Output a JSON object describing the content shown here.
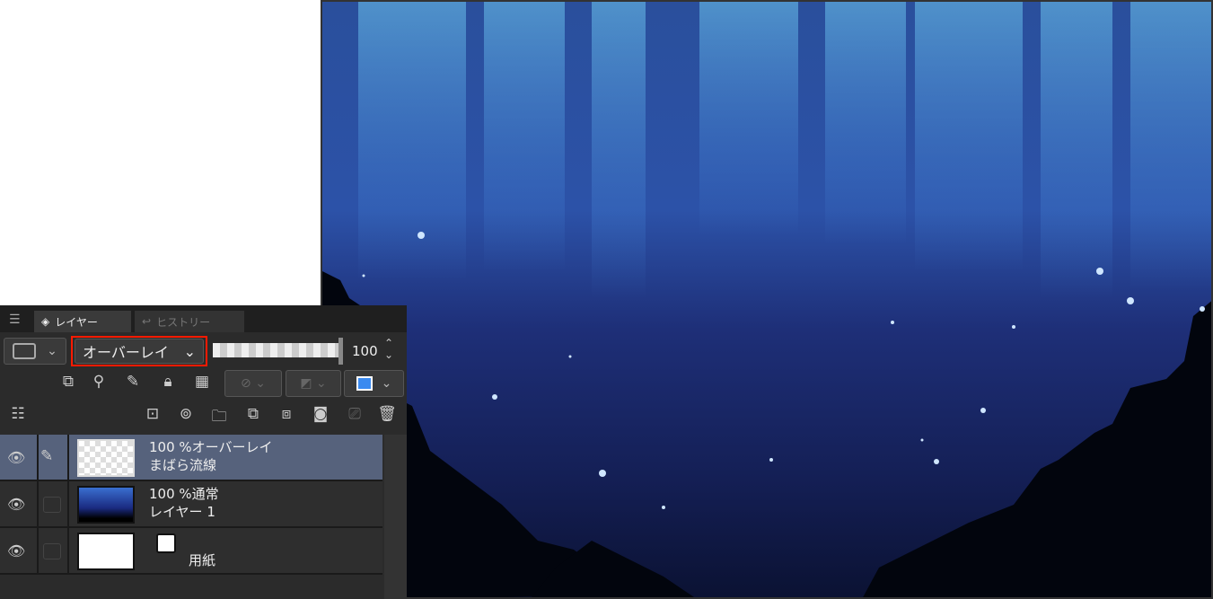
{
  "panel": {
    "tabs": [
      {
        "label": "レイヤー",
        "icon": "layers-icon"
      },
      {
        "label": "ヒストリー",
        "icon": "undo-icon"
      }
    ],
    "blend_mode": "オーバーレイ",
    "opacity": "100",
    "opacity_fraction": 1.0,
    "accent_highlight": "#ff1a00",
    "layers": [
      {
        "opacity_mode": "100 %オーバーレイ",
        "name": "まばら流線",
        "selected": true
      },
      {
        "opacity_mode": "100 %通常",
        "name": "レイヤー 1",
        "selected": false
      },
      {
        "opacity_mode": "",
        "name": "用紙",
        "selected": false
      }
    ]
  }
}
